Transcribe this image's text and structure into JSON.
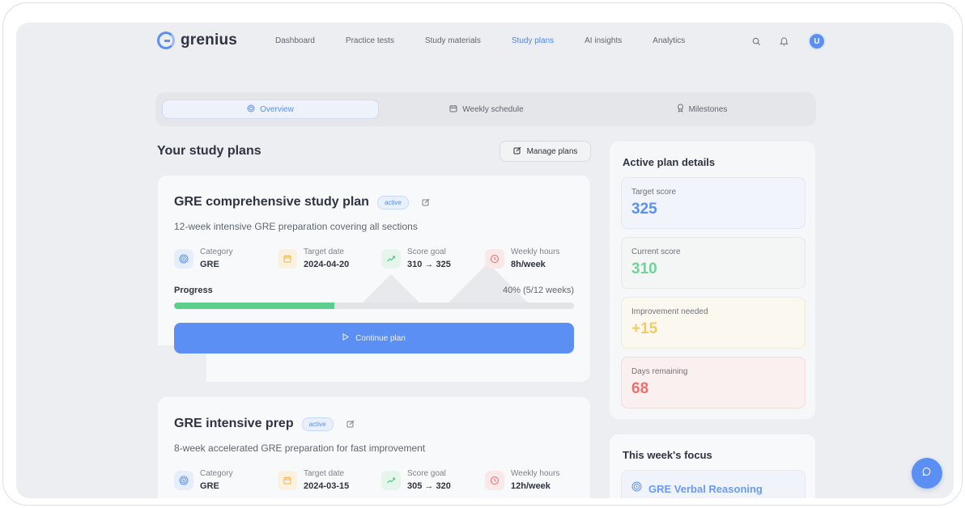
{
  "brand": {
    "name": "grenius"
  },
  "nav": {
    "links": [
      "Dashboard",
      "Practice tests",
      "Study materials",
      "Study plans",
      "AI insights",
      "Analytics"
    ],
    "active": "Study plans",
    "user_initial": "U"
  },
  "tabs": [
    {
      "label": "Overview",
      "icon": "target-icon",
      "active": true
    },
    {
      "label": "Weekly schedule",
      "icon": "calendar-icon",
      "active": false
    },
    {
      "label": "Milestones",
      "icon": "award-icon",
      "active": false
    }
  ],
  "section": {
    "title": "Your study plans",
    "manage_label": "Manage plans"
  },
  "meta_labels": {
    "category": "Category",
    "target_date": "Target date",
    "score_goal": "Score goal",
    "weekly_hours": "Weekly hours"
  },
  "plans": [
    {
      "title": "GRE comprehensive study plan",
      "status": "active",
      "description": "12-week intensive GRE preparation covering all sections",
      "category": "GRE",
      "target_date": "2024-04-20",
      "score_goal": "310 → 325",
      "weekly_hours": "8h/week",
      "progress_label": "Progress",
      "progress_text": "40% (5/12 weeks)",
      "progress_fraction": 0.4,
      "continue_label": "Continue plan"
    },
    {
      "title": "GRE intensive prep",
      "status": "active",
      "description": "8-week accelerated GRE preparation for fast improvement",
      "category": "GRE",
      "target_date": "2024-03-15",
      "score_goal": "305 → 320",
      "weekly_hours": "12h/week"
    }
  ],
  "details": {
    "title": "Active plan details",
    "target_label": "Target score",
    "target_value": "325",
    "current_label": "Current score",
    "current_value": "310",
    "improvement_label": "Improvement needed",
    "improvement_value": "+15",
    "days_label": "Days remaining",
    "days_value": "68"
  },
  "focus": {
    "title": "This week's focus",
    "item": "GRE Verbal Reasoning"
  },
  "colors": {
    "accent": "#5b8ff3",
    "progress": "#5ccf8c",
    "current": "#6fd39a",
    "improvement": "#f2cc62",
    "days": "#ee6d6d"
  }
}
